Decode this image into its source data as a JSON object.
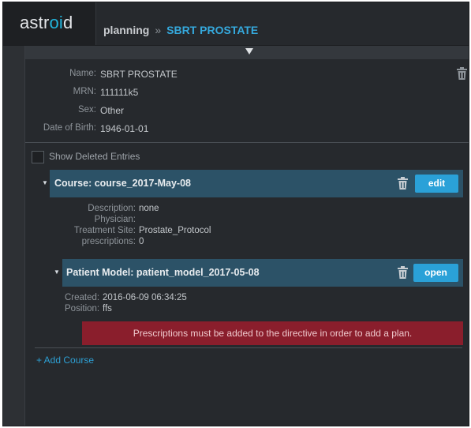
{
  "header": {
    "logo_prefix": "astr",
    "logo_mid": "oi",
    "logo_suffix": "d",
    "crumb_section": "planning",
    "crumb_separator": "»",
    "crumb_current": "SBRT PROSTATE"
  },
  "patient": {
    "name_label": "Name:",
    "name_value": "SBRT PROSTATE",
    "mrn_label": "MRN:",
    "mrn_value": "111111k5",
    "sex_label": "Sex:",
    "sex_value": "Other",
    "dob_label": "Date of Birth:",
    "dob_value": "1946-01-01"
  },
  "show_deleted": {
    "label": "Show Deleted Entries",
    "checked": false
  },
  "course": {
    "title": "Course: course_2017-May-08",
    "edit_label": "edit",
    "description_label": "Description:",
    "description_value": "none",
    "physician_label": "Physician:",
    "physician_value": "",
    "treatment_site_label": "Treatment Site:",
    "treatment_site_value": "Prostate_Protocol",
    "prescriptions_label": "prescriptions:",
    "prescriptions_value": "0"
  },
  "patient_model": {
    "title": "Patient Model: patient_model_2017-05-08",
    "open_label": "open",
    "created_label": "Created:",
    "created_value": "2016-06-09 06:34:25",
    "position_label": "Position:",
    "position_value": "ffs",
    "alert": "Prescriptions must be added to the directive in order to add a plan."
  },
  "add_course_label": "+ Add Course",
  "colors": {
    "accent": "#2aa1d8",
    "bar": "#2c5267",
    "alert": "#8a1e2c",
    "background": "#26292d"
  },
  "icons": [
    "collapse-triangle-icon",
    "trash-icon",
    "chevron-down-icon"
  ]
}
